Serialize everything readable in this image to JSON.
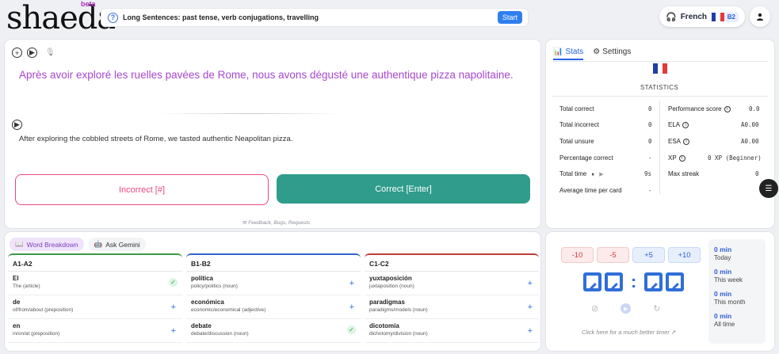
{
  "app": {
    "logo": "shaeda",
    "beta": "beta"
  },
  "lesson": {
    "title": "Long Sentences: past tense, verb conjugations, travelling",
    "start_label": "Start"
  },
  "language": {
    "name": "French",
    "level": "B2"
  },
  "card": {
    "sentence_fr": "Après avoir exploré les ruelles pavées de Rome, nous avons dégusté une authentique pizza napolitaine.",
    "sentence_en": "After exploring the cobbled streets of Rome, we tasted authentic Neapolitan pizza.",
    "incorrect_label": "Incorrect [#]",
    "correct_label": "Correct [Enter]",
    "feedback_label": "Feedback, Bugs, Requests"
  },
  "stats": {
    "tab_stats": "Stats",
    "tab_settings": "Settings",
    "title": "STATISTICS",
    "left": [
      {
        "label": "Total correct",
        "value": "0"
      },
      {
        "label": "Total incorrect",
        "value": "0"
      },
      {
        "label": "Total unsure",
        "value": "0"
      },
      {
        "label": "Percentage correct",
        "value": "-"
      },
      {
        "label": "Total time",
        "value": "9s"
      },
      {
        "label": "Average time per card",
        "value": "-"
      }
    ],
    "right": [
      {
        "label": "Performance score",
        "value": "0.0"
      },
      {
        "label": "ELA",
        "value": "A0.00"
      },
      {
        "label": "ESA",
        "value": "A0.00"
      },
      {
        "label": "XP",
        "value": "0 XP (Beginner)"
      },
      {
        "label": "Max streak",
        "value": "0"
      }
    ]
  },
  "words": {
    "tab_breakdown": "Word Breakdown",
    "tab_gemini": "Ask Gemini",
    "columns": [
      {
        "level": "A1-A2",
        "color": "#3a9a4a",
        "items": [
          {
            "word": "El",
            "gloss": "The (article)",
            "added": true
          },
          {
            "word": "de",
            "gloss": "of/from/about (preposition)",
            "added": false
          },
          {
            "word": "en",
            "gloss": "in/on/at (preposition)",
            "added": false
          }
        ]
      },
      {
        "level": "B1-B2",
        "color": "#3564c8",
        "items": [
          {
            "word": "política",
            "gloss": "policy/politics (noun)",
            "added": false
          },
          {
            "word": "económica",
            "gloss": "economic/economical (adjective)",
            "added": false
          },
          {
            "word": "debate",
            "gloss": "debate/discussion (noun)",
            "added": true
          }
        ]
      },
      {
        "level": "C1-C2",
        "color": "#c23a3a",
        "items": [
          {
            "word": "yuxtaposición",
            "gloss": "juxtaposition (noun)",
            "added": false
          },
          {
            "word": "paradigmas",
            "gloss": "paradigms/models (noun)",
            "added": false
          },
          {
            "word": "dicotomía",
            "gloss": "dichotomy/division (noun)",
            "added": false
          }
        ]
      }
    ]
  },
  "timer": {
    "adjust": [
      "-10",
      "-5",
      "+5",
      "+10"
    ],
    "link_label": "Click here for a much better timer",
    "summary": [
      {
        "value": "0 min",
        "label": "Today"
      },
      {
        "value": "0 min",
        "label": "This week"
      },
      {
        "value": "0 min",
        "label": "This month"
      },
      {
        "value": "0 min",
        "label": "All time"
      }
    ]
  },
  "colors": {
    "accent": "#2f7ef1",
    "correct": "#2f9c8c",
    "incorrect": "#e8497e",
    "french_text": "#a747cf"
  }
}
